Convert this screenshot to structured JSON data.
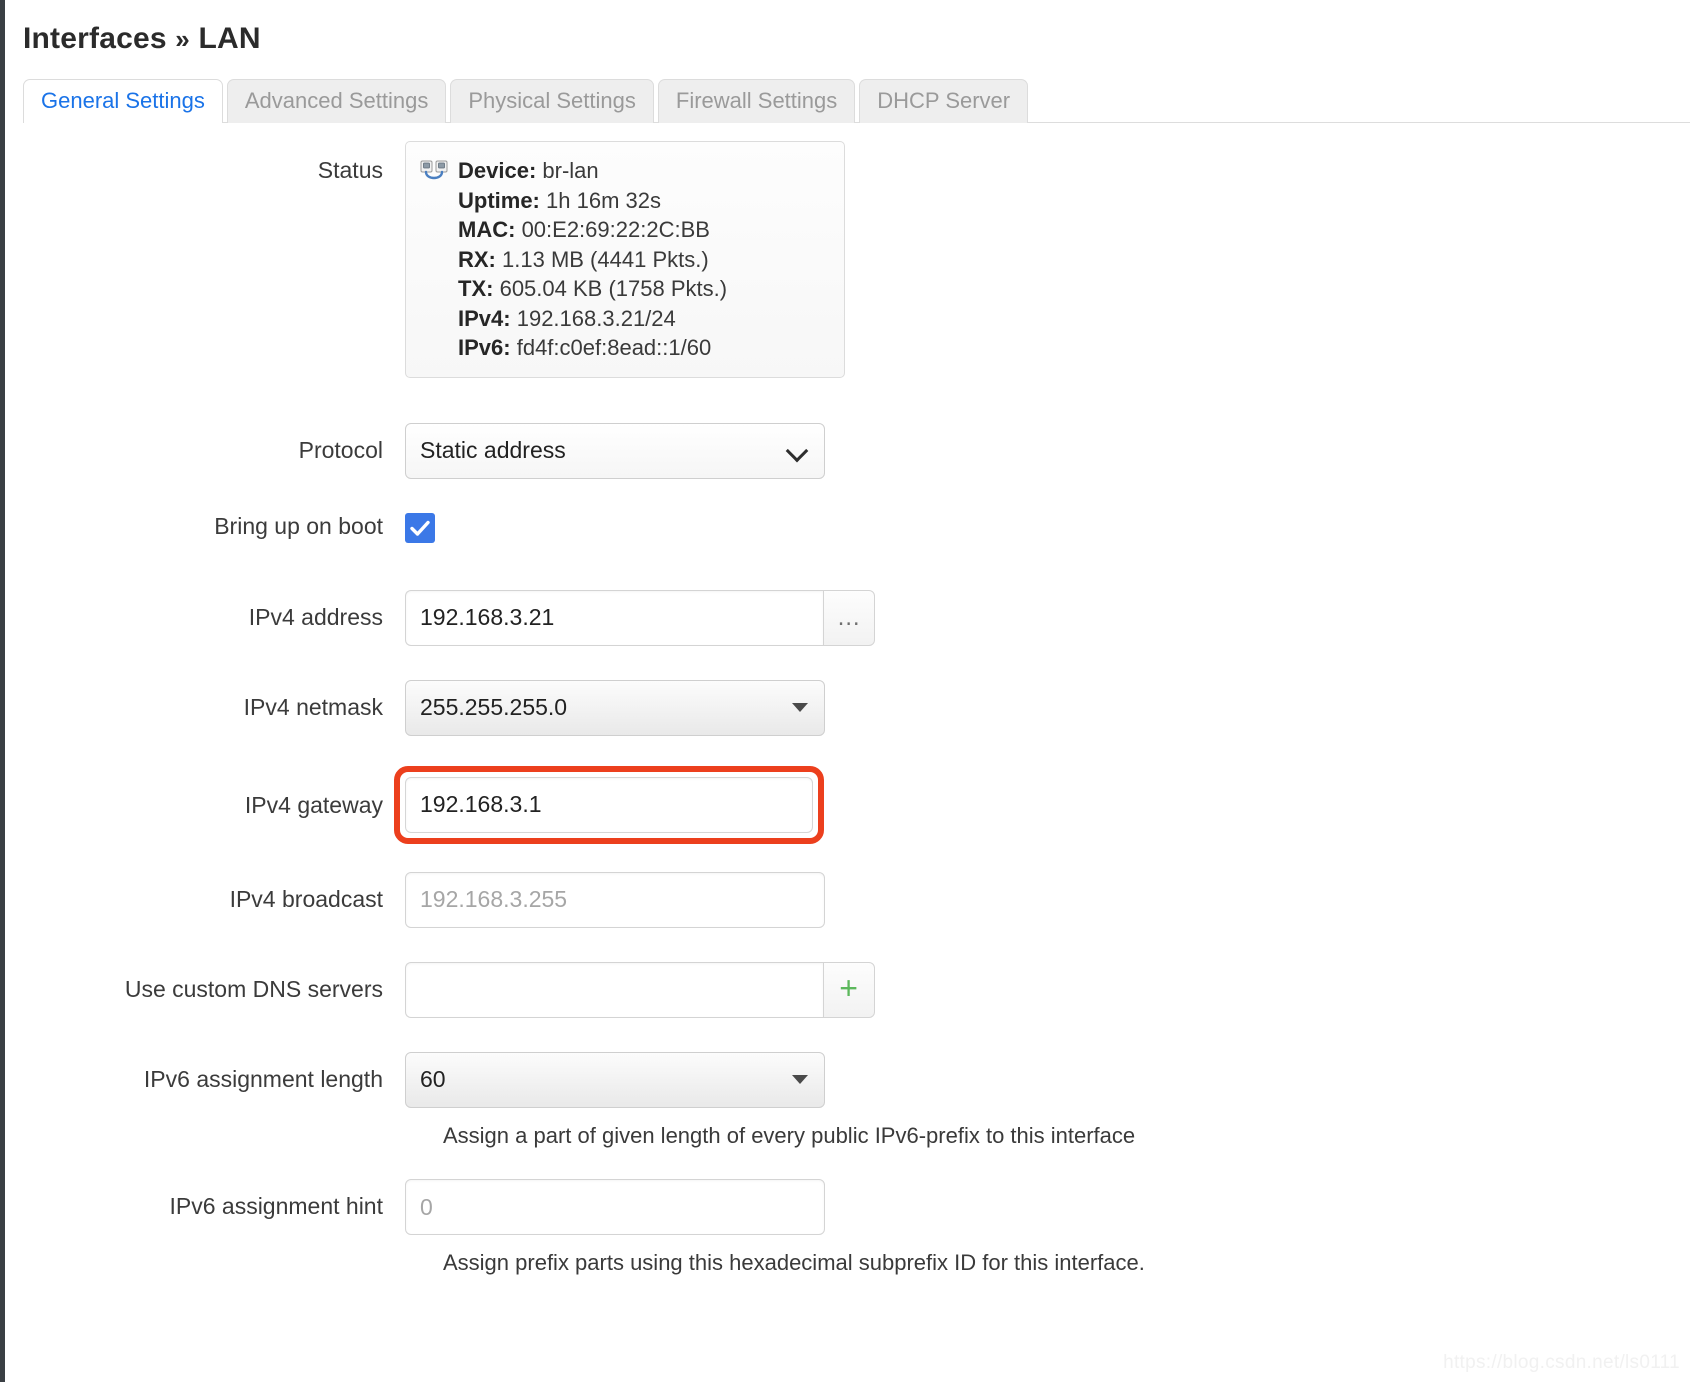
{
  "header": {
    "breadcrumb_root": "Interfaces",
    "breadcrumb_sep": "»",
    "breadcrumb_leaf": "LAN"
  },
  "tabs": [
    {
      "label": "General Settings",
      "active": true
    },
    {
      "label": "Advanced Settings",
      "active": false
    },
    {
      "label": "Physical Settings",
      "active": false
    },
    {
      "label": "Firewall Settings",
      "active": false
    },
    {
      "label": "DHCP Server",
      "active": false
    }
  ],
  "form": {
    "status": {
      "label": "Status",
      "icon": "network-bridge-icon",
      "lines": [
        {
          "key": "Device:",
          "value": "br-lan"
        },
        {
          "key": "Uptime:",
          "value": "1h 16m 32s"
        },
        {
          "key": "MAC:",
          "value": "00:E2:69:22:2C:BB"
        },
        {
          "key": "RX:",
          "value": "1.13 MB (4441 Pkts.)"
        },
        {
          "key": "TX:",
          "value": "605.04 KB (1758 Pkts.)"
        },
        {
          "key": "IPv4:",
          "value": "192.168.3.21/24"
        },
        {
          "key": "IPv6:",
          "value": "fd4f:c0ef:8ead::1/60"
        }
      ]
    },
    "protocol": {
      "label": "Protocol",
      "value": "Static address",
      "icon": "chevron-down-icon"
    },
    "bring_up_on_boot": {
      "label": "Bring up on boot",
      "checked": true,
      "accent": "#3b78e7"
    },
    "ipv4_address": {
      "label": "IPv4 address",
      "value": "192.168.3.21",
      "addon_label": "…"
    },
    "ipv4_netmask": {
      "label": "IPv4 netmask",
      "value": "255.255.255.0",
      "icon": "caret-down-icon"
    },
    "ipv4_gateway": {
      "label": "IPv4 gateway",
      "value": "192.168.3.1",
      "highlight_color": "#ec3f1d"
    },
    "ipv4_broadcast": {
      "label": "IPv4 broadcast",
      "placeholder": "192.168.3.255",
      "value": ""
    },
    "custom_dns": {
      "label": "Use custom DNS servers",
      "value": "",
      "addon_label": "+",
      "addon_color": "#5cb85c"
    },
    "ipv6_assignment_length": {
      "label": "IPv6 assignment length",
      "value": "60",
      "help": "Assign a part of given length of every public IPv6-prefix to this interface",
      "icon": "caret-down-icon"
    },
    "ipv6_assignment_hint": {
      "label": "IPv6 assignment hint",
      "placeholder": "0",
      "value": "",
      "help": "Assign prefix parts using this hexadecimal subprefix ID for this interface."
    }
  },
  "watermark": "https://blog.csdn.net/ls0111"
}
